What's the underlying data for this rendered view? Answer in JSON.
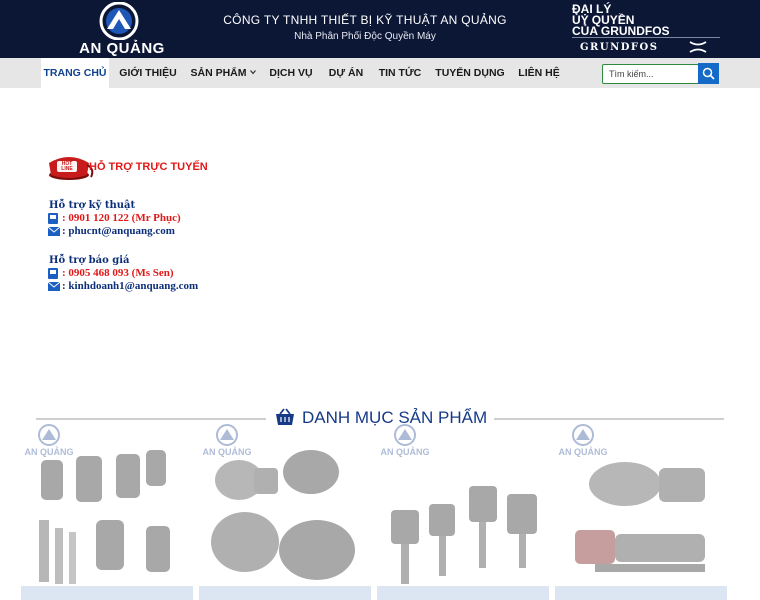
{
  "header": {
    "logo_text": "AN QUẢNG",
    "company_name": "CÔNG TY TNHH THIẾT BỊ KỸ THUẬT AN QUẢNG",
    "company_sub": "Nhà Phân Phối Độc Quyền Máy",
    "dealer_lines": [
      "ĐẠI LÝ",
      "ỦY QUYỀN",
      "CỦA GRUNDFOS"
    ],
    "grundfos_brand": "GRUNDFOS",
    "bg_color": "#0c1736"
  },
  "nav": {
    "items": [
      {
        "label": "TRANG CHỦ",
        "active": true
      },
      {
        "label": "GIỚI THIỆU"
      },
      {
        "label": "SẢN PHẨM",
        "has_dropdown": true
      },
      {
        "label": "DỊCH VỤ"
      },
      {
        "label": "DỰ ÁN"
      },
      {
        "label": "TIN TỨC"
      },
      {
        "label": "TUYỂN DỤNG"
      },
      {
        "label": "LIÊN HỆ"
      }
    ],
    "search_placeholder": "Tìm kiếm...",
    "search_icon": "search-icon"
  },
  "support": {
    "hotline_badge": "HOT LINE",
    "title": "HỖ TRỢ TRỰC TUYẾN",
    "technical": {
      "title": "Hỗ trợ kỹ thuật",
      "phone": ": 0901 120 122 (Mr Phục)",
      "email": ": phucnt@anquang.com"
    },
    "quote": {
      "title": "Hỗ trợ báo giá",
      "phone": ": 0905 468 093 (Ms Sen)",
      "email": ": kinhdoanh1@anquang.com"
    }
  },
  "categories": {
    "title": "DANH MỤC SẢN PHẨM",
    "watermark": "AN QUẢNG",
    "cards": [
      {
        "id": "submersible-pumps"
      },
      {
        "id": "surface-pumps"
      },
      {
        "id": "vertical-pumps"
      },
      {
        "id": "multistage-pumps"
      }
    ]
  },
  "colors": {
    "accent_blue": "#163a86",
    "hotline_red": "#e01919",
    "search_green": "#2b8a3e",
    "search_button": "#1569c7"
  }
}
